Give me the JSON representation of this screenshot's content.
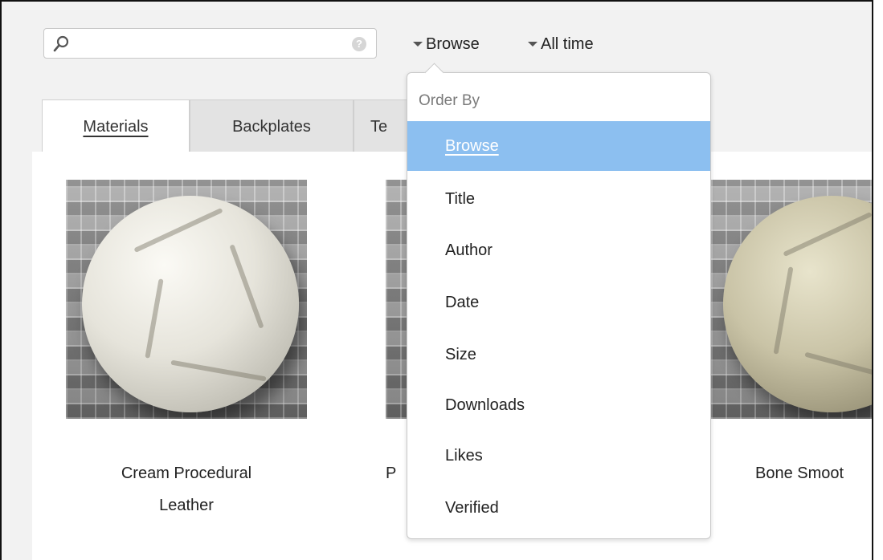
{
  "search": {
    "value": "",
    "help_glyph": "?"
  },
  "filters": {
    "order_label": "Browse",
    "time_label": "All time"
  },
  "tabs": [
    {
      "label": "Materials"
    },
    {
      "label": "Backplates"
    },
    {
      "label": "Te"
    }
  ],
  "cards": [
    {
      "title_line1": "Cream Procedural",
      "title_line2": "Leather"
    },
    {
      "title_line1": "P",
      "title_line2": ""
    },
    {
      "title_line1": "Bone Smoot",
      "title_line2": ""
    }
  ],
  "order_menu": {
    "header": "Order By",
    "items": [
      {
        "label": "Browse"
      },
      {
        "label": "Title"
      },
      {
        "label": "Author"
      },
      {
        "label": "Date"
      },
      {
        "label": "Size"
      },
      {
        "label": "Downloads"
      },
      {
        "label": "Likes"
      },
      {
        "label": "Verified"
      }
    ]
  },
  "colors": {
    "selection": "#8cbff0",
    "sphere_cream": "#e6e4db",
    "sphere_bone": "#c9c3a6"
  }
}
